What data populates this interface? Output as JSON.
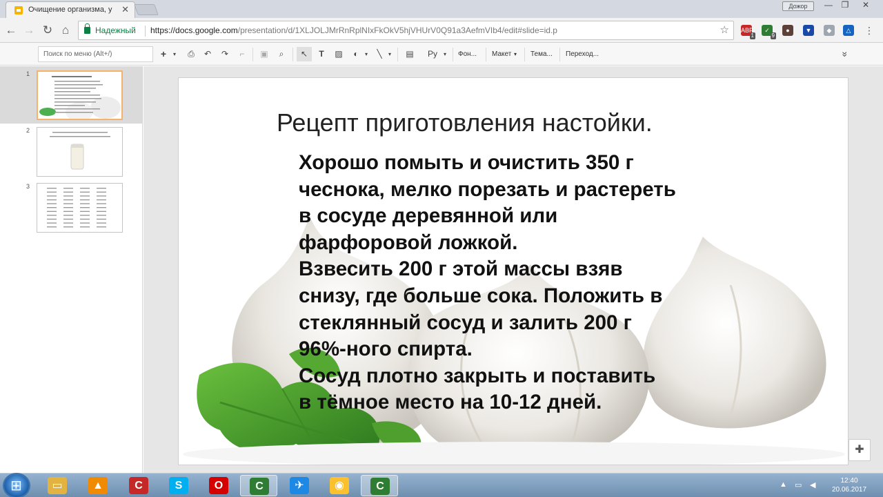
{
  "browser": {
    "tab_title": "Очищение организма, у",
    "tab_close": "✕",
    "profile_label": "Дожор",
    "window_buttons": [
      "—",
      "❐",
      "✕"
    ],
    "secure_label": "Надежный",
    "url_host": "https://docs.google.com",
    "url_path": "/presentation/d/1XLJOLJMrRnRplNIxFkOkV5hjVHUrV0Q91a3AefmVIb4/edit#slide=id.p",
    "nav_icons": [
      "back-icon",
      "forward-icon",
      "reload-icon",
      "home-icon"
    ],
    "extensions": [
      {
        "name": "abp",
        "label": "ABP",
        "badge": "1",
        "color": "#c62828"
      },
      {
        "name": "shield-green",
        "label": "✓",
        "badge": "9",
        "color": "#2e7d32"
      },
      {
        "name": "fox",
        "label": "●",
        "badge": "",
        "color": "#5d4037"
      },
      {
        "name": "shield-blue",
        "label": "▼",
        "badge": "",
        "color": "#1a4aa8"
      },
      {
        "name": "diamond",
        "label": "◆",
        "badge": "",
        "color": "#9ea7b0"
      },
      {
        "name": "drive",
        "label": "△",
        "badge": "",
        "color": "#1565c0"
      },
      {
        "name": "menu",
        "label": "⋮",
        "badge": "",
        "color": "#f2f2f2"
      }
    ]
  },
  "toolbar": {
    "menu_search_placeholder": "Поиск по меню (Alt+/)",
    "add_label": "+",
    "font_label": "Ру",
    "background_label": "Фон...",
    "layout_label": "Макет",
    "theme_label": "Тема...",
    "transition_label": "Переход...",
    "collapse_label": "»"
  },
  "filmstrip": {
    "slides": [
      {
        "number": "1"
      },
      {
        "number": "2"
      },
      {
        "number": "3"
      }
    ]
  },
  "slide": {
    "title": "Рецепт приготовления настойки.",
    "body_lines": [
      "Хорошо помыть и очистить  350 г",
      "чеснока, мелко порезать и растереть",
      "в сосуде деревянной или",
      "фарфоровой ложкой.",
      "  Взвесить 200 г этой массы взяв",
      "снизу, где больше сока. Положить в",
      "стеклянный сосуд и залить 200 г",
      "96%-ного спирта.",
      "  Сосуд плотно закрыть и поставить",
      "в тёмное место на 10-12 дней."
    ]
  },
  "taskbar": {
    "apps": [
      {
        "name": "explorer",
        "active": false,
        "color": "#e3b341"
      },
      {
        "name": "vlc",
        "active": false,
        "color": "#f08a00"
      },
      {
        "name": "cleaner",
        "active": false,
        "color": "#c62828"
      },
      {
        "name": "skype",
        "active": false,
        "color": "#00aff0"
      },
      {
        "name": "opera",
        "active": false,
        "color": "#d50000"
      },
      {
        "name": "camtasia",
        "active": true,
        "color": "#2e7d32"
      },
      {
        "name": "telegram-like",
        "active": false,
        "color": "#1e88e5"
      },
      {
        "name": "chrome",
        "active": false,
        "color": "#fbc02d"
      },
      {
        "name": "camtasia-2",
        "active": true,
        "color": "#2e7d32"
      }
    ],
    "time": "12:40",
    "date": "20.06.2017"
  }
}
